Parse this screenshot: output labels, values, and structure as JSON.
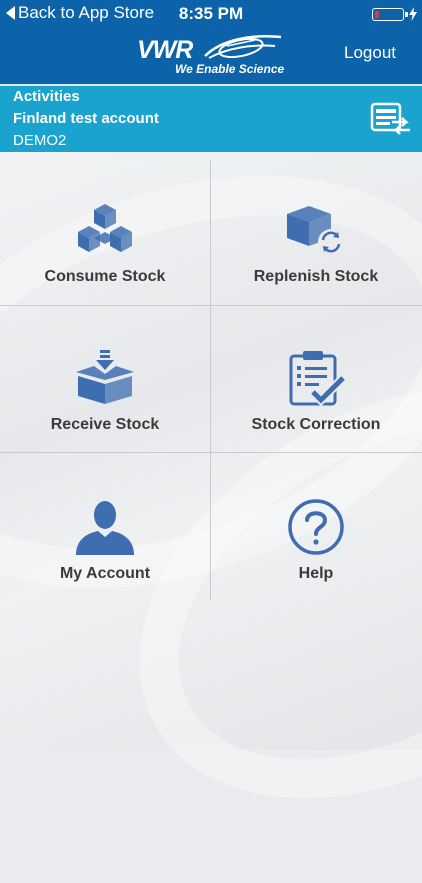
{
  "status_bar": {
    "back_label": "Back to App Store",
    "time": "8:35 PM"
  },
  "header": {
    "logo_text": "VWR",
    "tagline": "We Enable Science",
    "logout_label": "Logout"
  },
  "info_banner": {
    "title": "Activities",
    "account_name": "Finland test account",
    "account_code": "DEMO2"
  },
  "menu": [
    {
      "label": "Consume Stock",
      "icon": "boxes-icon"
    },
    {
      "label": "Replenish Stock",
      "icon": "box-refresh-icon"
    },
    {
      "label": "Receive Stock",
      "icon": "receive-box-icon"
    },
    {
      "label": "Stock Correction",
      "icon": "clipboard-check-icon"
    },
    {
      "label": "My Account",
      "icon": "user-icon"
    },
    {
      "label": "Help",
      "icon": "help-icon"
    }
  ],
  "colors": {
    "header_blue": "#0d63aa",
    "banner_cyan": "#1aa3cf",
    "icon_blue": "#3e6db0"
  }
}
